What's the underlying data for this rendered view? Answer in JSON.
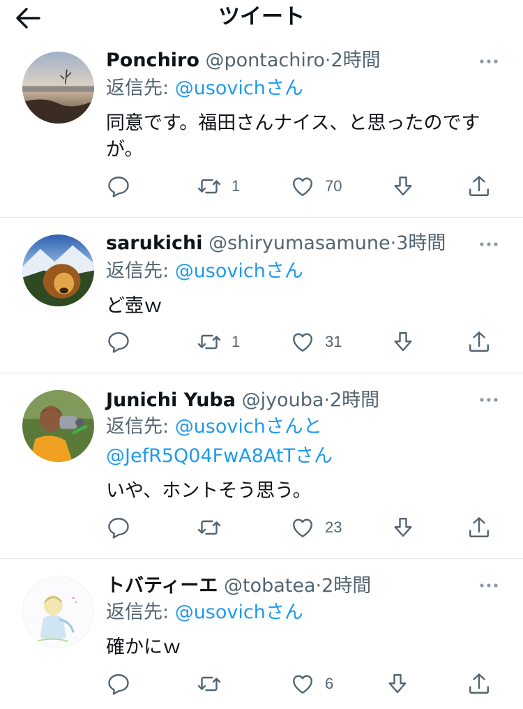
{
  "header": {
    "title": "ツイート"
  },
  "reply_prefix": "返信先: ",
  "tweets": [
    {
      "name": "Ponchiro",
      "handle": "@pontachiro",
      "time": "2時間",
      "reply_to": "@usovich",
      "reply_suffix": "さん",
      "text_line1": "同意です。福田さんナイス、と思ったのです",
      "text_line2": "が。",
      "retweets": "1",
      "likes": "70"
    },
    {
      "name": "sarukichi",
      "handle": "@shiryumasamune",
      "time": "3時間",
      "reply_to": "@usovich",
      "reply_suffix": "さん",
      "text_line1": "ど壺ｗ",
      "retweets": "1",
      "likes": "31"
    },
    {
      "name": "Junichi Yuba",
      "handle": "@jyouba",
      "time": "2時間",
      "reply_to": "@usovich",
      "reply_suffix": "さんと",
      "reply_to2": "@JefR5Q04FwA8AtT",
      "reply_suffix2": "さん",
      "text_line1": "いや、ホントそう思う。",
      "retweets": "",
      "likes": "23"
    },
    {
      "name": "トバティーエ",
      "handle": "@tobatea",
      "time": "2時間",
      "reply_to": "@usovich",
      "reply_suffix": "さん",
      "text_line1": "確かにｗ",
      "retweets": "",
      "likes": "6"
    }
  ],
  "separator": "·",
  "icons": {
    "back": "arrow-left-icon",
    "reply": "comment-bubble-icon",
    "retweet": "retweet-arrows-icon",
    "like": "heart-icon",
    "bookmark": "download-arrow-icon",
    "share": "share-upload-icon",
    "more": "ellipsis-icon"
  },
  "colors": {
    "link": "#1d9bf0",
    "muted": "#536471",
    "text": "#0f1419",
    "divider": "#e1e5e8"
  }
}
